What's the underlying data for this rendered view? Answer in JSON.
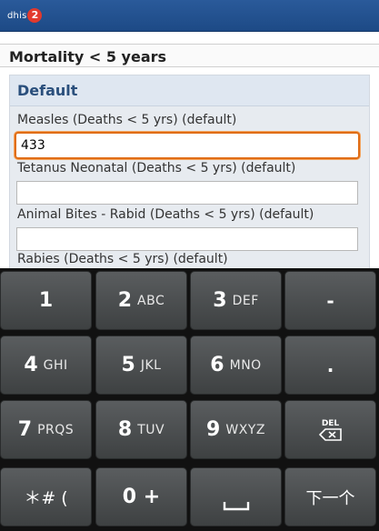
{
  "app": {
    "logo_text": "dhis",
    "logo_badge": "2"
  },
  "page": {
    "title": "Mortality < 5 years"
  },
  "section": {
    "title": "Default"
  },
  "fields": [
    {
      "label": "Measles (Deaths < 5 yrs) (default)",
      "value": "433"
    },
    {
      "label": "Tetanus Neonatal (Deaths < 5 yrs) (default)",
      "value": ""
    },
    {
      "label": "Animal Bites - Rabid (Deaths < 5 yrs) (default)",
      "value": ""
    },
    {
      "label": "Rabies (Deaths < 5 yrs) (default)",
      "value": ""
    }
  ],
  "keyboard": {
    "keys": [
      {
        "main": "1",
        "sub": ""
      },
      {
        "main": "2",
        "sub": "ABC"
      },
      {
        "main": "3",
        "sub": "DEF"
      },
      {
        "main": "-",
        "sub": ""
      },
      {
        "main": "4",
        "sub": "GHI"
      },
      {
        "main": "5",
        "sub": "JKL"
      },
      {
        "main": "6",
        "sub": "MNO"
      },
      {
        "main": ".",
        "sub": ""
      },
      {
        "main": "7",
        "sub": "PRQS"
      },
      {
        "main": "8",
        "sub": "TUV"
      },
      {
        "main": "9",
        "sub": "WXYZ"
      },
      {
        "main": "DEL",
        "sub": ""
      },
      {
        "main": "＊# (",
        "sub": ""
      },
      {
        "main": "0 +",
        "sub": ""
      },
      {
        "main": "",
        "sub": ""
      },
      {
        "main": "下一个",
        "sub": ""
      }
    ],
    "del_icon": "backspace-icon",
    "space_icon": "space-icon"
  }
}
